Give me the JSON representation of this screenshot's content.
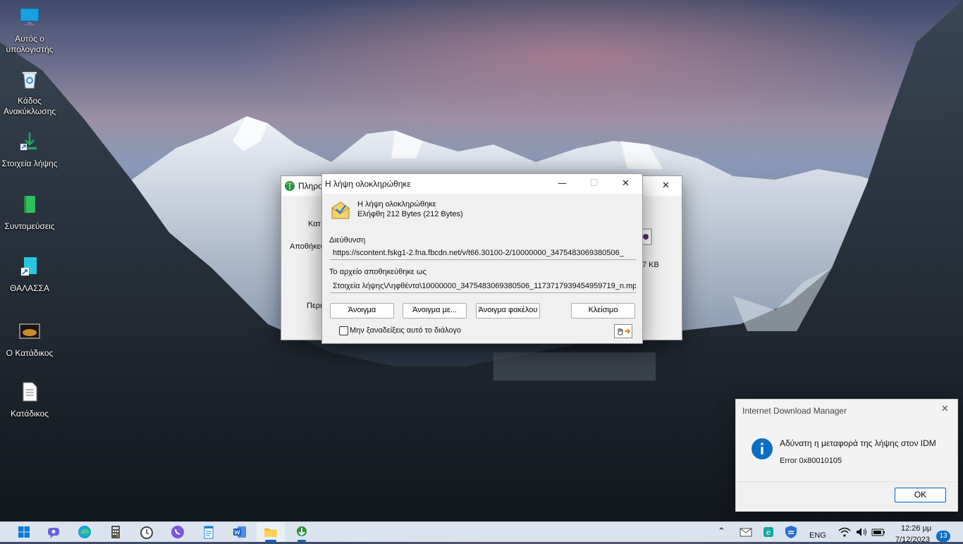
{
  "desktop": {
    "icons": [
      {
        "label": "Αυτός ο υπολογιστής",
        "icon": "monitor-icon"
      },
      {
        "label": "Κάδος Ανακύκλωσης",
        "icon": "recycle-bin-icon"
      },
      {
        "label": "Στοιχεία λήψης",
        "icon": "download-folder-icon"
      },
      {
        "label": "Συντομεύσεις",
        "icon": "green-book-icon"
      },
      {
        "label": "ΘΑΛΑΣΣΑ",
        "icon": "shortcut-icon"
      },
      {
        "label": "Ο Κατάδικος",
        "icon": "video-thumbnail-icon"
      },
      {
        "label": "Κατάδικος",
        "icon": "text-document-icon"
      }
    ]
  },
  "back_window": {
    "title": "Πληρο",
    "labels": [
      "Κατ",
      "Αποθήκευ",
      "Περι"
    ],
    "size_text": "7 KB"
  },
  "dialog": {
    "title": "Η λήψη ολοκληρώθηκε",
    "status_line1": "Η λήψη ολοκληρώθηκε",
    "status_line2": "Ελήφθη 212  Bytes (212 Bytes)",
    "address_label": "Διεύθυνση",
    "address_value": "https://scontent.fskg1-2.fna.fbcdn.net/v/t66.30100-2/10000000_3475483069380506_",
    "saved_label": "Το αρχείο αποθηκεύθηκε ως",
    "saved_value": "Στοιχεία λήψης\\Ληφθέντα\\10000000_3475483069380506_1173717939454959719_n.mp",
    "buttons": {
      "open": "Άνοιγμα",
      "open_with": "Άνοιγμα με...",
      "open_folder": "Άνοιγμα φακέλου",
      "close": "Κλείσιμο"
    },
    "checkbox_label": "Μην ξαναδείξεις αυτό το διάλογο",
    "checkbox_checked": false
  },
  "toast": {
    "app": "Internet Download Manager",
    "message": "Αδύνατη η μεταφορά της λήψης στον IDM",
    "error": "Error 0x80010105",
    "ok": "OK"
  },
  "taskbar": {
    "apps": [
      "windows-start-icon",
      "teams-chat-icon",
      "edge-icon",
      "calculator-icon",
      "clock-app-icon",
      "viber-icon",
      "notepad-icon",
      "word-icon",
      "file-explorer-icon",
      "idm-icon"
    ],
    "language": "ENG",
    "time": "12:26 μμ",
    "date": "7/12/2023",
    "notification_count": "13"
  },
  "colors": {
    "accent": "#0067c0",
    "info": "#0a6fc2"
  }
}
